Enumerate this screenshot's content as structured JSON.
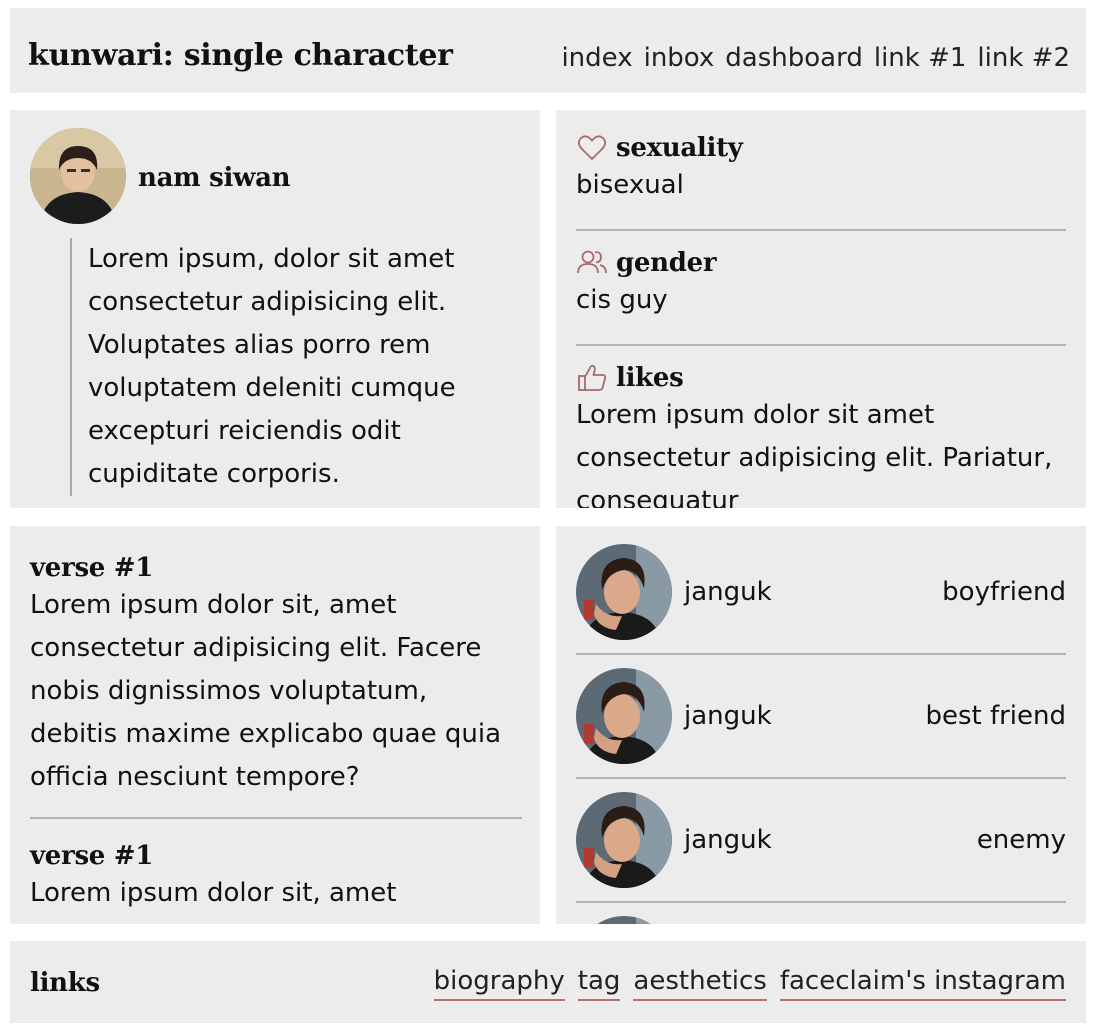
{
  "header": {
    "title": "kunwari: single character",
    "nav": [
      "index",
      "inbox",
      "dashboard",
      "link #1",
      "link #2"
    ]
  },
  "profile": {
    "name": "nam siwan",
    "bio": "Lorem ipsum, dolor sit amet consectetur adipisicing elit. Voluptates alias porro rem voluptatem deleniti cumque excepturi reiciendis odit cupiditate corporis."
  },
  "stats": [
    {
      "icon": "heart-icon",
      "label": "sexuality",
      "value": "bisexual"
    },
    {
      "icon": "users-icon",
      "label": "gender",
      "value": "cis guy"
    },
    {
      "icon": "thumbs-up-icon",
      "label": "likes",
      "value": "Lorem ipsum dolor sit amet consectetur adipisicing elit. Pariatur, consequatur"
    }
  ],
  "verses": [
    {
      "title": "verse #1",
      "text": "Lorem ipsum dolor sit, amet consectetur adipisicing elit. Facere nobis dignissimos voluptatum, debitis maxime explicabo quae quia officia nesciunt tempore?"
    },
    {
      "title": "verse #1",
      "text": "Lorem ipsum dolor sit, amet"
    }
  ],
  "relations": [
    {
      "name": "janguk",
      "type": "boyfriend"
    },
    {
      "name": "janguk",
      "type": "best friend"
    },
    {
      "name": "janguk",
      "type": "enemy"
    }
  ],
  "links": {
    "title": "links",
    "items": [
      "biography",
      "tag",
      "aesthetics",
      "faceclaim's instagram"
    ]
  },
  "colors": {
    "panel": "#ececec",
    "accent": "#a86a6a",
    "rule": "#b3b3b3"
  }
}
